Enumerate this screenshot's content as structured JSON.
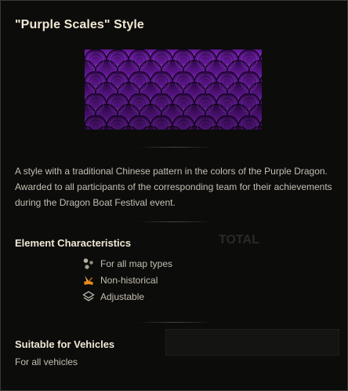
{
  "tooltip": {
    "title": "\"Purple Scales\" Style",
    "preview_image": "purple-dragon-scale-pattern",
    "description": "A style with a traditional Chinese pattern in the colors of the Purple Dragon. Awarded to all participants of the corresponding team for their achievements during the Dragon Boat Festival event.",
    "characteristics": {
      "heading": "Element Characteristics",
      "items": [
        {
          "icon": "map-types-icon",
          "label": "For all map types"
        },
        {
          "icon": "non-historical-icon",
          "label": "Non-historical"
        },
        {
          "icon": "adjustable-icon",
          "label": "Adjustable"
        }
      ]
    },
    "vehicles": {
      "heading": "Suitable for Vehicles",
      "value": "For all vehicles"
    }
  },
  "colors": {
    "background": "#0c0c0b",
    "heading": "#f0e8d4",
    "body_text": "#c4bfb2",
    "scale_purple": "#8a2fc4",
    "non_historical_icon": "#f0a020"
  }
}
